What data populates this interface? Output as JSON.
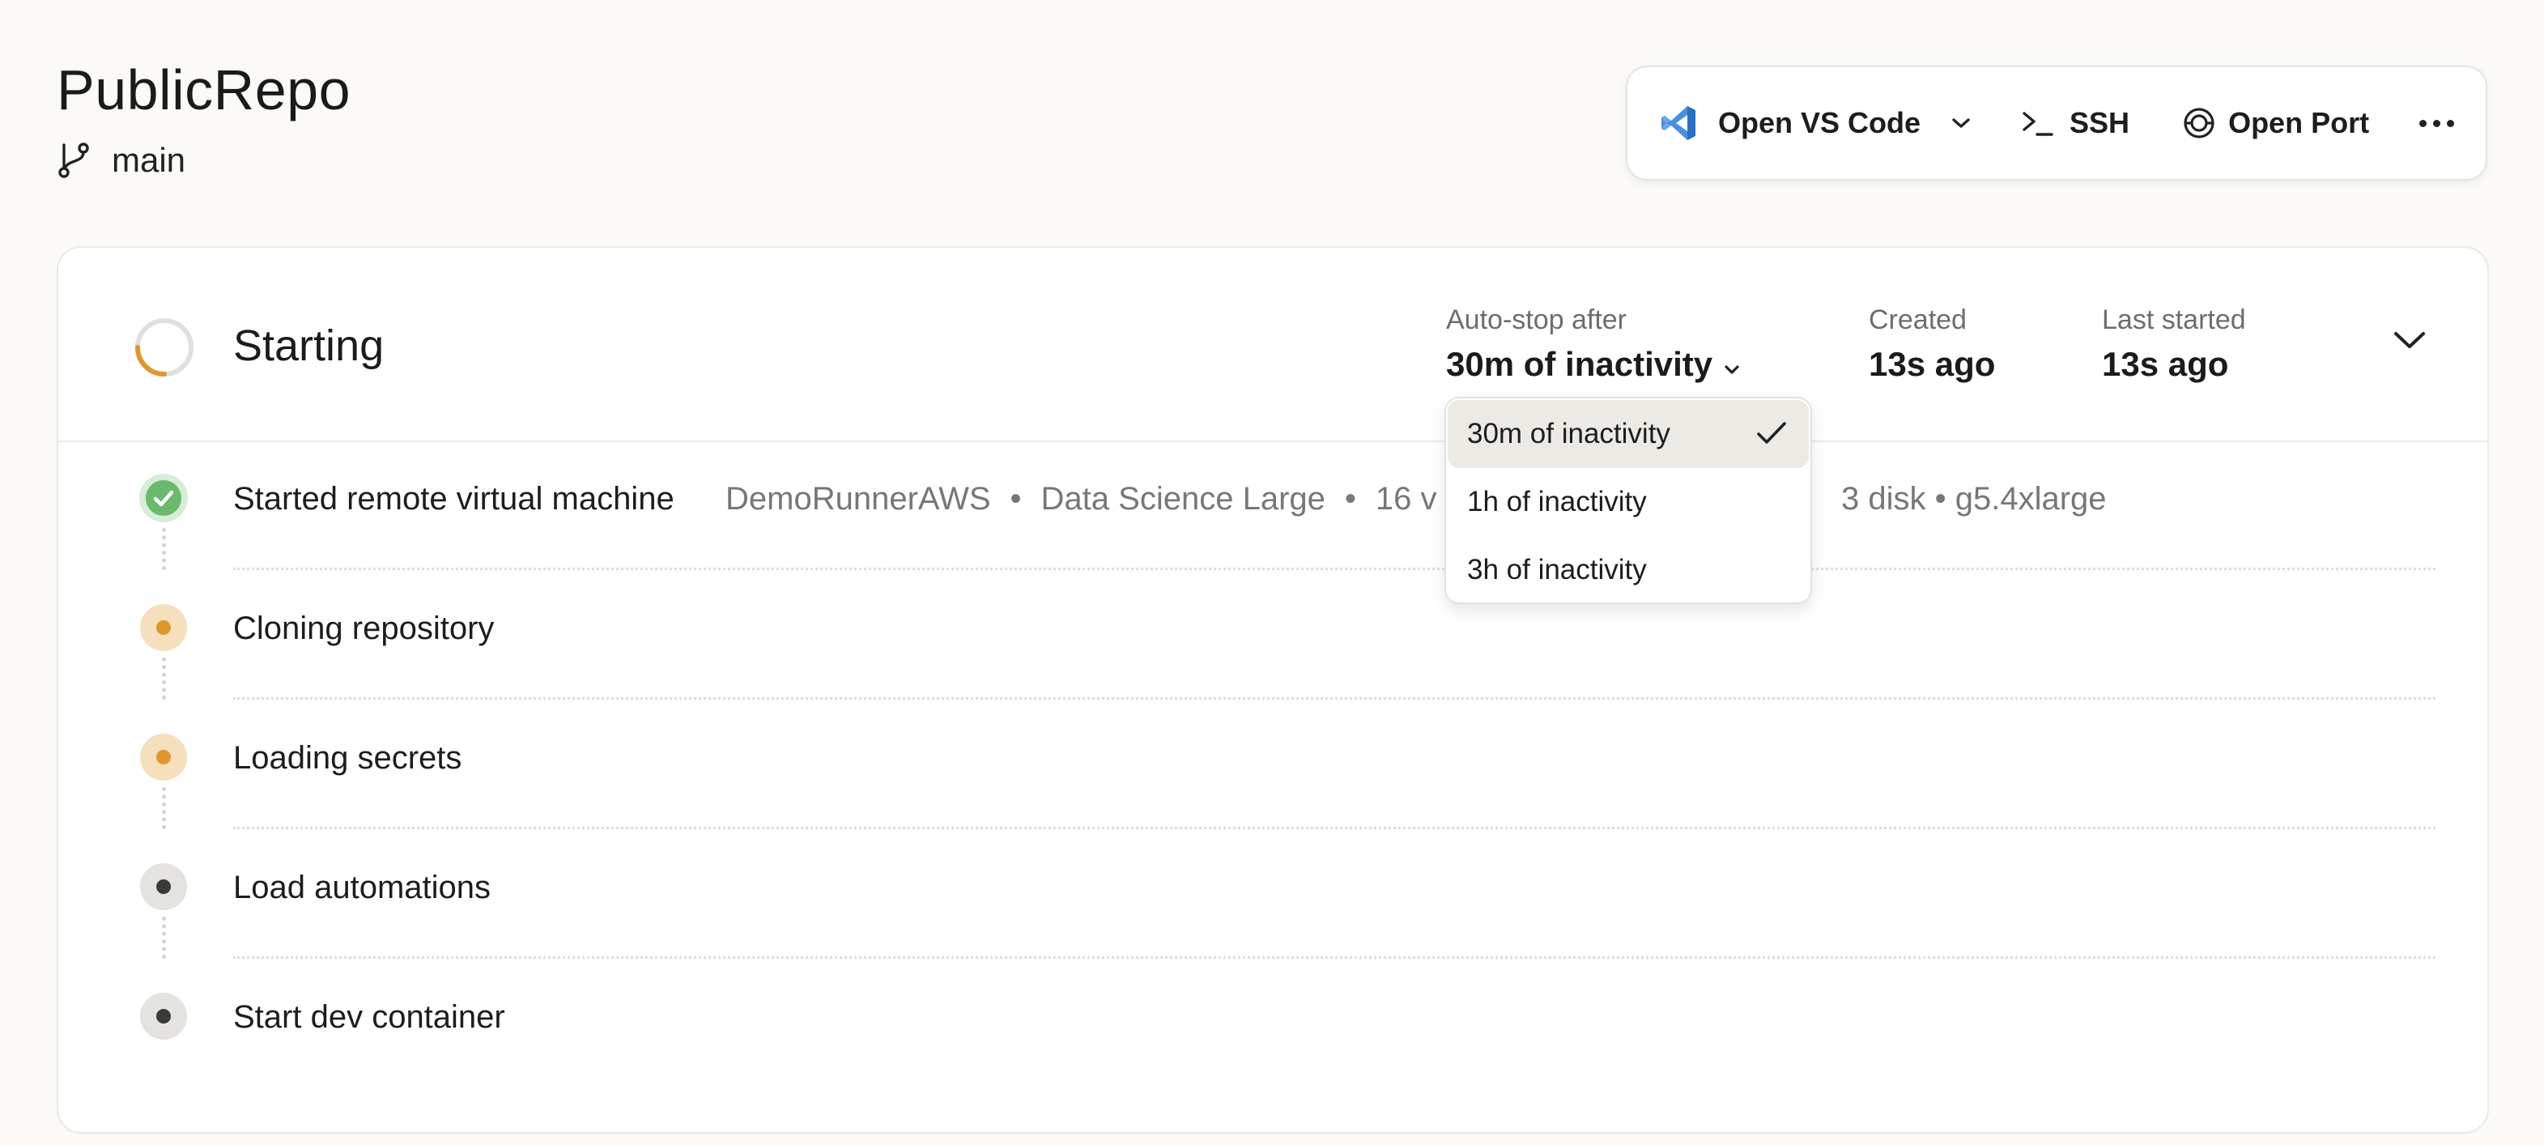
{
  "header": {
    "repo_name": "PublicRepo",
    "branch": "main"
  },
  "toolbar": {
    "open_vscode": "Open VS Code",
    "ssh": "SSH",
    "open_port": "Open Port"
  },
  "status": {
    "title": "Starting",
    "autostop_label": "Auto-stop after",
    "autostop_value": "30m of inactivity",
    "created_label": "Created",
    "created_value": "13s ago",
    "last_started_label": "Last started",
    "last_started_value": "13s ago"
  },
  "steps": [
    {
      "label": "Started remote virtual machine",
      "state": "done",
      "details": {
        "runner": "DemoRunnerAWS",
        "class": "Data Science Large",
        "cpu_partial": "16 v",
        "tail": "3 disk • g5.4xlarge"
      }
    },
    {
      "label": "Cloning repository",
      "state": "in-progress"
    },
    {
      "label": "Loading secrets",
      "state": "in-progress"
    },
    {
      "label": "Load automations",
      "state": "pending"
    },
    {
      "label": "Start dev container",
      "state": "pending"
    }
  ],
  "autostop_dropdown": {
    "options": [
      "30m of inactivity",
      "1h of inactivity",
      "3h of inactivity"
    ],
    "selected": "30m of inactivity"
  },
  "colors": {
    "background": "#fbfaf6",
    "done_green": "#6ab96d",
    "progress_orange": "#e0962f",
    "vscode_blue": "#3b7fd1"
  },
  "icons": {
    "branch": "git-branch-icon",
    "vscode": "vscode-logo-icon",
    "terminal": "terminal-icon",
    "port": "port-icon",
    "more": "more-horizontal-icon",
    "check": "check-icon",
    "chevron": "chevron-down-icon",
    "spinner": "spinner-icon"
  }
}
